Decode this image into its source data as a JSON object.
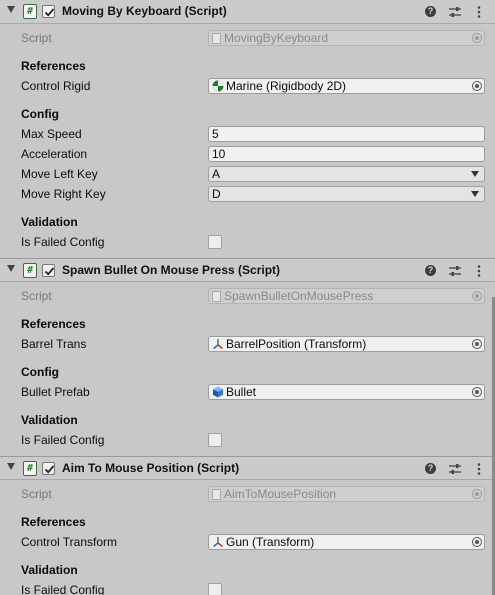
{
  "components": [
    {
      "title": "Moving By Keyboard (Script)",
      "enabled": true,
      "script_label": "Script",
      "script_value": "MovingByKeyboard",
      "sections": [
        {
          "heading": "References",
          "rows": [
            {
              "label": "Control Rigid",
              "type": "object",
              "value": "Marine (Rigidbody 2D)",
              "icon": "rigidbody-2d-icon"
            }
          ]
        },
        {
          "heading": "Config",
          "rows": [
            {
              "label": "Max Speed",
              "type": "number",
              "value": "5"
            },
            {
              "label": "Acceleration",
              "type": "number",
              "value": "10"
            },
            {
              "label": "Move Left Key",
              "type": "dropdown",
              "value": "A"
            },
            {
              "label": "Move Right Key",
              "type": "dropdown",
              "value": "D"
            }
          ]
        },
        {
          "heading": "Validation",
          "rows": [
            {
              "label": "Is Failed Config",
              "type": "checkbox",
              "checked": false
            }
          ]
        }
      ]
    },
    {
      "title": "Spawn Bullet On Mouse Press (Script)",
      "enabled": true,
      "script_label": "Script",
      "script_value": "SpawnBulletOnMousePress",
      "sections": [
        {
          "heading": "References",
          "rows": [
            {
              "label": "Barrel Trans",
              "type": "object",
              "value": "BarrelPosition (Transform)",
              "icon": "transform-icon"
            }
          ]
        },
        {
          "heading": "Config",
          "rows": [
            {
              "label": "Bullet Prefab",
              "type": "object",
              "value": "Bullet",
              "icon": "prefab-icon"
            }
          ]
        },
        {
          "heading": "Validation",
          "rows": [
            {
              "label": "Is Failed Config",
              "type": "checkbox",
              "checked": false
            }
          ]
        }
      ]
    },
    {
      "title": "Aim To Mouse Position (Script)",
      "enabled": true,
      "script_label": "Script",
      "script_value": "AimToMousePosition",
      "sections": [
        {
          "heading": "References",
          "rows": [
            {
              "label": "Control Transform",
              "type": "object",
              "value": "Gun (Transform)",
              "icon": "transform-icon"
            }
          ]
        },
        {
          "heading": "Validation",
          "rows": [
            {
              "label": "Is Failed Config",
              "type": "checkbox",
              "checked": false
            }
          ]
        }
      ]
    }
  ],
  "header_icons": [
    "help-icon",
    "preset-icon",
    "more-options-icon"
  ],
  "colors": {
    "background": "#c8c8c8",
    "header": "#cbcbcb",
    "field": "#f0f0f0",
    "disabled_text": "#8a8a8a",
    "script_icon_green": "#2f7d2f"
  }
}
